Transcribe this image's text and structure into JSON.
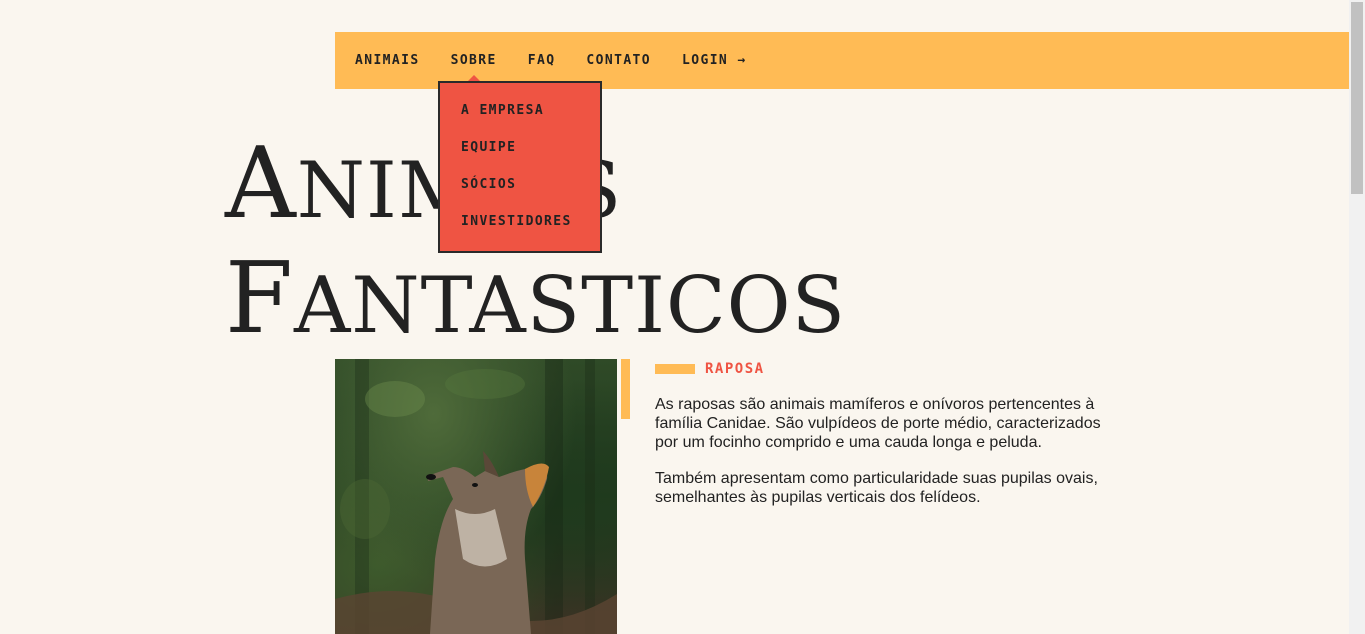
{
  "nav": {
    "items": [
      {
        "label": "ANIMAIS"
      },
      {
        "label": "SOBRE"
      },
      {
        "label": "FAQ"
      },
      {
        "label": "CONTATO"
      },
      {
        "label": "LOGIN →"
      }
    ],
    "submenu": {
      "parent": "SOBRE",
      "items": [
        {
          "label": "A EMPRESA"
        },
        {
          "label": "EQUIPE"
        },
        {
          "label": "SÓCIOS"
        },
        {
          "label": "INVESTIDORES"
        }
      ]
    }
  },
  "hero": {
    "title_line1_cap": "A",
    "title_line1_rest": "NIMAIS",
    "title_line2_cap": "F",
    "title_line2_rest": "ANTASTICOS"
  },
  "animal": {
    "name": "RAPOSA",
    "paragraphs": [
      "As raposas são animais mamíferos e onívoros pertencentes à família Canidae. São vulpídeos de porte médio, caracterizados por um focinho comprido e uma cauda longa e peluda.",
      "Também apresentam como particularidade suas pupilas ovais, semelhantes às pupilas verticais dos felídeos."
    ]
  },
  "colors": {
    "background": "#faf6ef",
    "nav": "#ffbb55",
    "submenu": "#ef5443",
    "accent": "#ef5443",
    "text": "#222222"
  }
}
